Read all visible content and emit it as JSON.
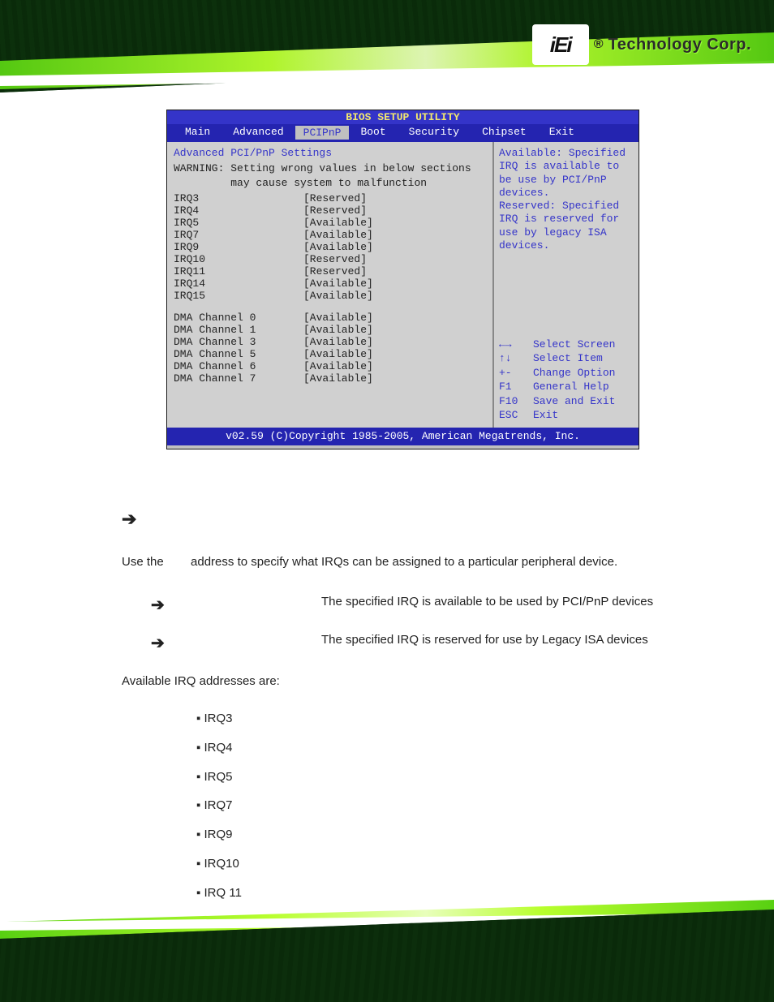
{
  "logo": {
    "mark": "iEi",
    "reg": "®",
    "text": "Technology Corp."
  },
  "bios": {
    "title": "BIOS SETUP UTILITY",
    "menu": [
      "Main",
      "Advanced",
      "PCIPnP",
      "Boot",
      "Security",
      "Chipset",
      "Exit"
    ],
    "selected_menu_index": 2,
    "heading": "Advanced PCI/PnP Settings",
    "warning_l1": "WARNING: Setting wrong values in below sections",
    "warning_l2": "         may cause system to malfunction",
    "rows": [
      {
        "k": "IRQ3",
        "v": "[Reserved]"
      },
      {
        "k": "IRQ4",
        "v": "[Reserved]"
      },
      {
        "k": "IRQ5",
        "v": "[Available]"
      },
      {
        "k": "IRQ7",
        "v": "[Available]"
      },
      {
        "k": "IRQ9",
        "v": "[Available]"
      },
      {
        "k": "IRQ10",
        "v": "[Reserved]"
      },
      {
        "k": "IRQ11",
        "v": "[Reserved]"
      },
      {
        "k": "IRQ14",
        "v": "[Available]"
      },
      {
        "k": "IRQ15",
        "v": "[Available]"
      }
    ],
    "dma_rows": [
      {
        "k": "DMA Channel 0",
        "v": "[Available]"
      },
      {
        "k": "DMA Channel 1",
        "v": "[Available]"
      },
      {
        "k": "DMA Channel 3",
        "v": "[Available]"
      },
      {
        "k": "DMA Channel 5",
        "v": "[Available]"
      },
      {
        "k": "DMA Channel 6",
        "v": "[Available]"
      },
      {
        "k": "DMA Channel 7",
        "v": "[Available]"
      }
    ],
    "help_lines": [
      "Available: Specified",
      "IRQ is available to",
      "be use by PCI/PnP",
      "devices.",
      "Reserved: Specified",
      "IRQ is reserved for",
      "use by legacy ISA",
      "devices."
    ],
    "nav": [
      {
        "k": "←→",
        "v": "Select Screen"
      },
      {
        "k": "↑↓",
        "v": "Select Item"
      },
      {
        "k": "+-",
        "v": "Change Option"
      },
      {
        "k": "F1",
        "v": "General Help"
      },
      {
        "k": "F10",
        "v": "Save and Exit"
      },
      {
        "k": "ESC",
        "v": "Exit"
      }
    ],
    "footer": "v02.59 (C)Copyright 1985-2005, American Megatrends, Inc."
  },
  "body": {
    "lead_arrow": "➔",
    "para": "Use the        address to specify what IRQs can be assigned to a particular peripheral device.",
    "options": [
      {
        "arrow": "➔",
        "text": "The specified IRQ is available to be used by PCI/PnP devices"
      },
      {
        "arrow": "➔",
        "text": "The specified IRQ is reserved for use by Legacy ISA devices"
      }
    ],
    "subheading": "Available IRQ addresses are:",
    "irqs": [
      "IRQ3",
      "IRQ4",
      "IRQ5",
      "IRQ7",
      "IRQ9",
      "IRQ10",
      "IRQ 11"
    ]
  }
}
